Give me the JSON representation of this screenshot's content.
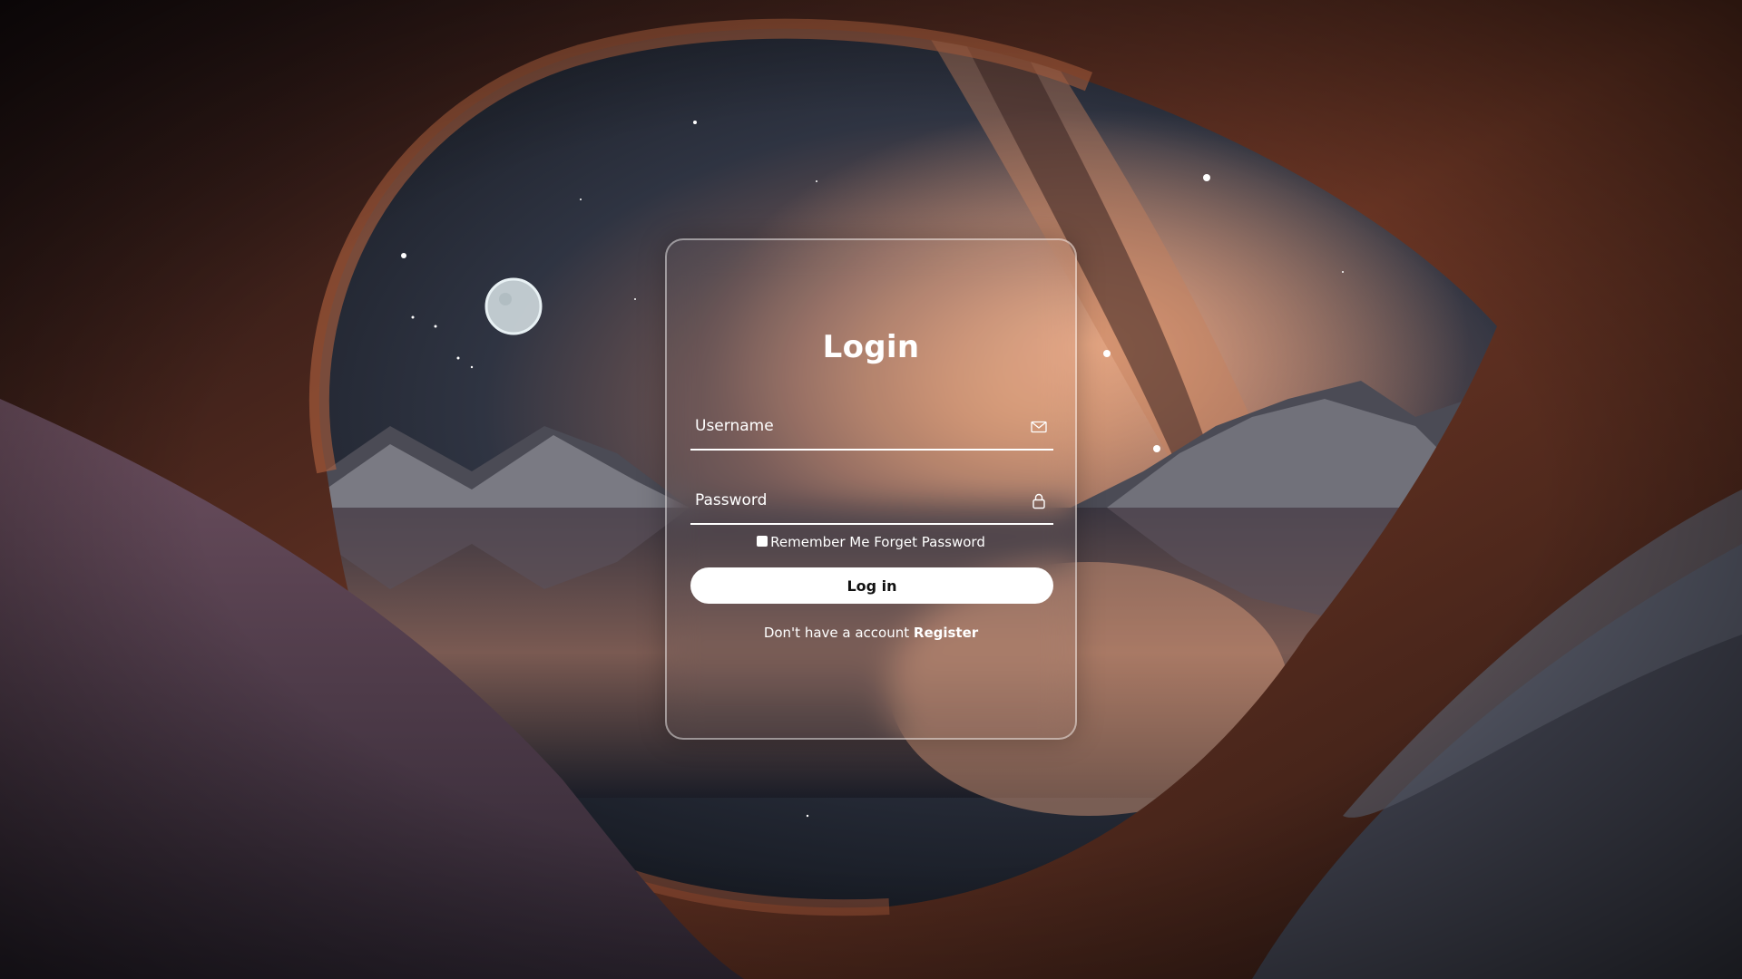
{
  "login": {
    "title": "Login",
    "username_placeholder": "Username",
    "password_placeholder": "Password",
    "username_icon": "mail-icon",
    "password_icon": "lock-icon",
    "remember_label": "Remember Me",
    "forget_label": "Forget Password",
    "login_button": "Log in",
    "register_prompt": "Don't have a account",
    "register_link": "Register"
  },
  "colors": {
    "text": "#ffffff",
    "button_bg": "#ffffff",
    "button_text": "#111111",
    "card_border": "rgba(255,255,255,0.45)"
  }
}
